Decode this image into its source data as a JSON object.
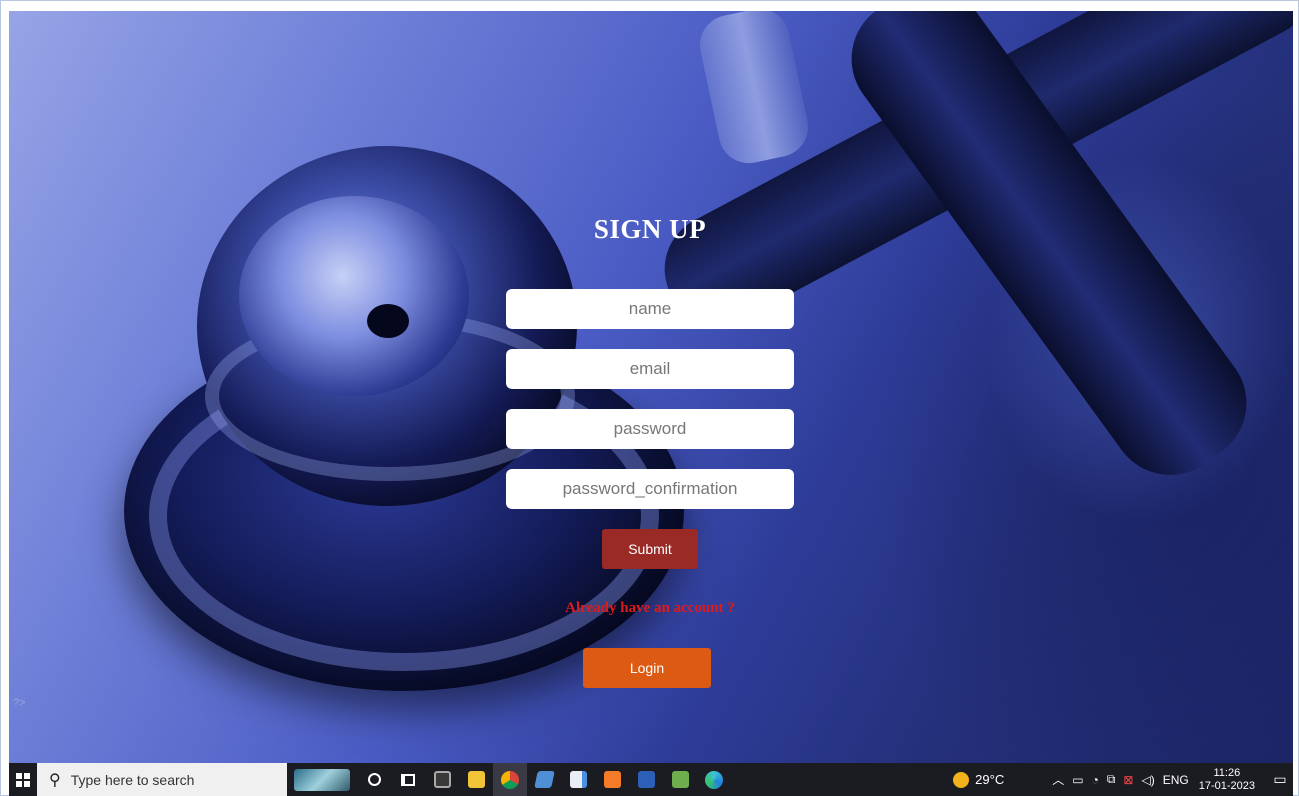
{
  "form": {
    "title": "SIGN UP",
    "fields": [
      {
        "name": "name",
        "placeholder": "name",
        "value": ""
      },
      {
        "name": "email",
        "placeholder": "email",
        "value": ""
      },
      {
        "name": "password",
        "placeholder": "password",
        "value": ""
      },
      {
        "name": "password_confirmation",
        "placeholder": "password_confirmation",
        "value": ""
      }
    ],
    "submit_label": "Submit",
    "already_text": "Already have an account ?",
    "login_label": "Login",
    "stray_text": "?>"
  },
  "colors": {
    "submit_button": "#9a2a26",
    "login_button": "#dc5a14",
    "link_text": "#e01a1a",
    "background_tint": "#3a4bb4"
  },
  "taskbar": {
    "search_placeholder": "Type here to search",
    "apps": [
      "cortana-icon",
      "task-view-icon",
      "terminal-icon",
      "file-explorer-icon",
      "chrome-icon",
      "app-icon",
      "notes-icon",
      "xampp-icon",
      "word-icon",
      "excel-icon",
      "edge-icon"
    ],
    "weather": "29°C",
    "language": "ENG",
    "time": "11:26",
    "date": "17-01-2023"
  }
}
